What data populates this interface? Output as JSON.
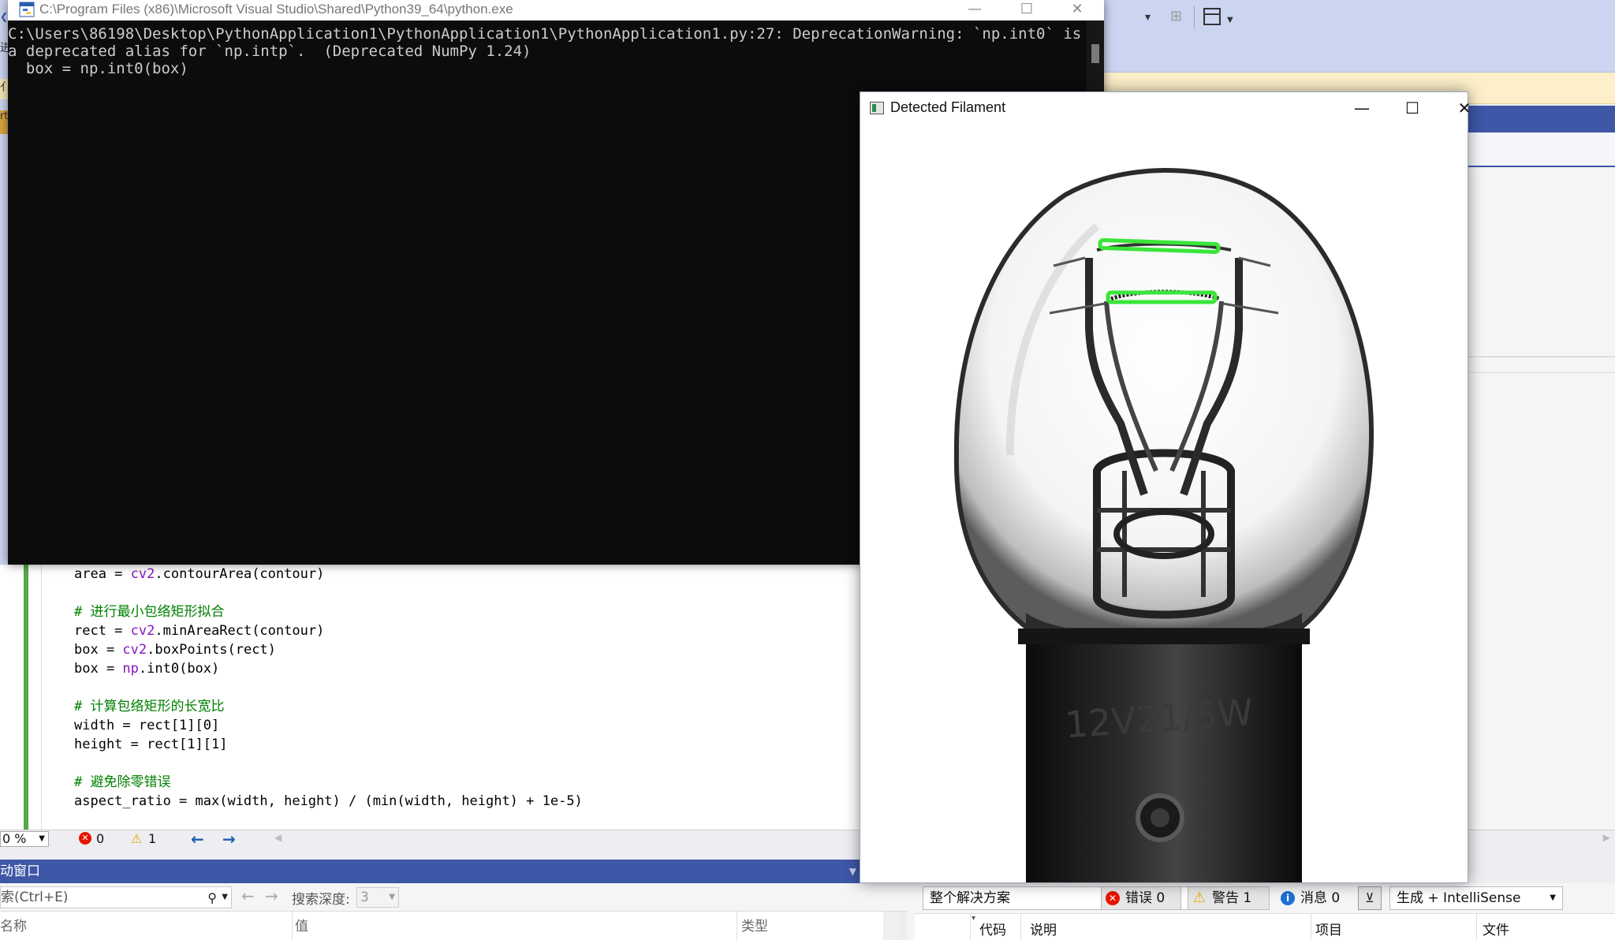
{
  "console": {
    "title": "C:\\Program Files (x86)\\Microsoft Visual Studio\\Shared\\Python39_64\\python.exe",
    "lines": [
      "C:\\Users\\86198\\Desktop\\PythonApplication1\\PythonApplication1\\PythonApplication1.py:27: DeprecationWarning: `np.int0` is",
      "a deprecated alias for `np.intp`.  (Deprecated NumPy 1.24)",
      "  box = np.int0(box)"
    ],
    "minimize_label": "—",
    "maximize_label": "☐",
    "close_label": "✕"
  },
  "image_window": {
    "title": "Detected Filament",
    "minimize_label": "—",
    "maximize_label": "☐",
    "close_label": "✕",
    "bulb_text": "12V21/5W",
    "highlight_color": "#39e639"
  },
  "editor": {
    "code": {
      "l1_a": "area = ",
      "l1_mod": "cv2",
      "l1_b": ".contourArea(contour)",
      "l3": "# 进行最小包络矩形拟合",
      "l4_a": "rect = ",
      "l4_mod": "cv2",
      "l4_b": ".minAreaRect(contour)",
      "l5_a": "box = ",
      "l5_mod": "cv2",
      "l5_b": ".boxPoints(rect)",
      "l6_a": "box = ",
      "l6_mod": "np",
      "l6_b": ".int0(box)",
      "l8": "# 计算包络矩形的长宽比",
      "l9": "width = rect[1][0]",
      "l10": "height = rect[1][1]",
      "l12": "# 避免除零错误",
      "l13": "aspect_ratio = max(width, height) / (min(width, height) + 1e-5)"
    },
    "status": {
      "zoom": "0 %",
      "errors": "0",
      "warnings": "1"
    }
  },
  "left_sliver": {
    "s2": "进",
    "s3": "亻",
    "s4": "rt"
  },
  "auto_window": {
    "title": "动窗口",
    "search_placeholder": "索(Ctrl+E)",
    "depth_label": "搜索深度:",
    "depth_value": "3",
    "columns": [
      "名称",
      "值",
      "类型"
    ]
  },
  "error_list": {
    "scope": "整个解决方案",
    "errors_label": "错误 0",
    "warnings_label": "警告 1",
    "messages_label": "消息 0",
    "build_filter": "生成 + IntelliSense",
    "columns": [
      "代码",
      "说明",
      "项目",
      "文件"
    ]
  }
}
